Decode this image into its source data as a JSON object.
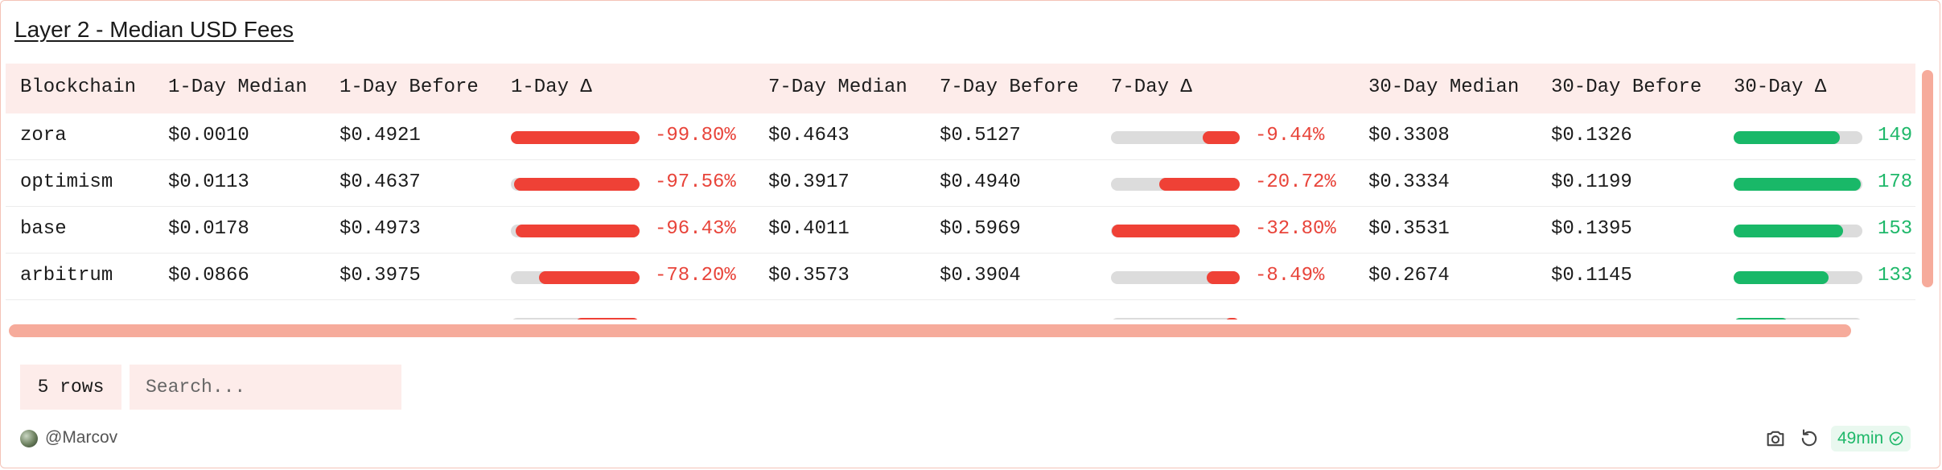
{
  "title": "Layer 2 - Median USD Fees",
  "columns": [
    "Blockchain",
    "1-Day Median",
    "1-Day Before",
    "1-Day Δ",
    "7-Day Median",
    "7-Day Before",
    "7-Day Δ",
    "30-Day Median",
    "30-Day Before",
    "30-Day Δ"
  ],
  "rows": [
    {
      "chain": "zora",
      "d1": "$0.0010",
      "d1b": "$0.4921",
      "d1d": "-99.80%",
      "d1p": -99.8,
      "d7": "$0.4643",
      "d7b": "$0.5127",
      "d7d": "-9.44%",
      "d7p": -9.44,
      "d30": "$0.3308",
      "d30b": "$0.1326",
      "d30d": "149",
      "d30p": 149
    },
    {
      "chain": "optimism",
      "d1": "$0.0113",
      "d1b": "$0.4637",
      "d1d": "-97.56%",
      "d1p": -97.56,
      "d7": "$0.3917",
      "d7b": "$0.4940",
      "d7d": "-20.72%",
      "d7p": -20.72,
      "d30": "$0.3334",
      "d30b": "$0.1199",
      "d30d": "178",
      "d30p": 178
    },
    {
      "chain": "base",
      "d1": "$0.0178",
      "d1b": "$0.4973",
      "d1d": "-96.43%",
      "d1p": -96.43,
      "d7": "$0.4011",
      "d7b": "$0.5969",
      "d7d": "-32.80%",
      "d7p": -32.8,
      "d30": "$0.3531",
      "d30b": "$0.1395",
      "d30d": "153",
      "d30p": 153
    },
    {
      "chain": "arbitrum",
      "d1": "$0.0866",
      "d1b": "$0.3975",
      "d1d": "-78.20%",
      "d1p": -78.2,
      "d7": "$0.3573",
      "d7b": "$0.3904",
      "d7d": "-8.49%",
      "d7p": -8.49,
      "d30": "$0.2674",
      "d30b": "$0.1145",
      "d30d": "133",
      "d30p": 133
    },
    {
      "chain": "",
      "d1": "",
      "d1b": "",
      "d1d": "",
      "d1p": -50.0,
      "d7": "",
      "d7b": "",
      "d7d": "",
      "d7p": -4.0,
      "d30": "",
      "d30b": "",
      "d30d": "",
      "d30p": 76
    }
  ],
  "rows_button": "5 rows",
  "search_placeholder": "Search...",
  "author": "@Marcov",
  "refresh_time": "49min",
  "colors": {
    "negative": "#ef4136",
    "positive": "#19b868",
    "accent": "#f6ab9b"
  }
}
